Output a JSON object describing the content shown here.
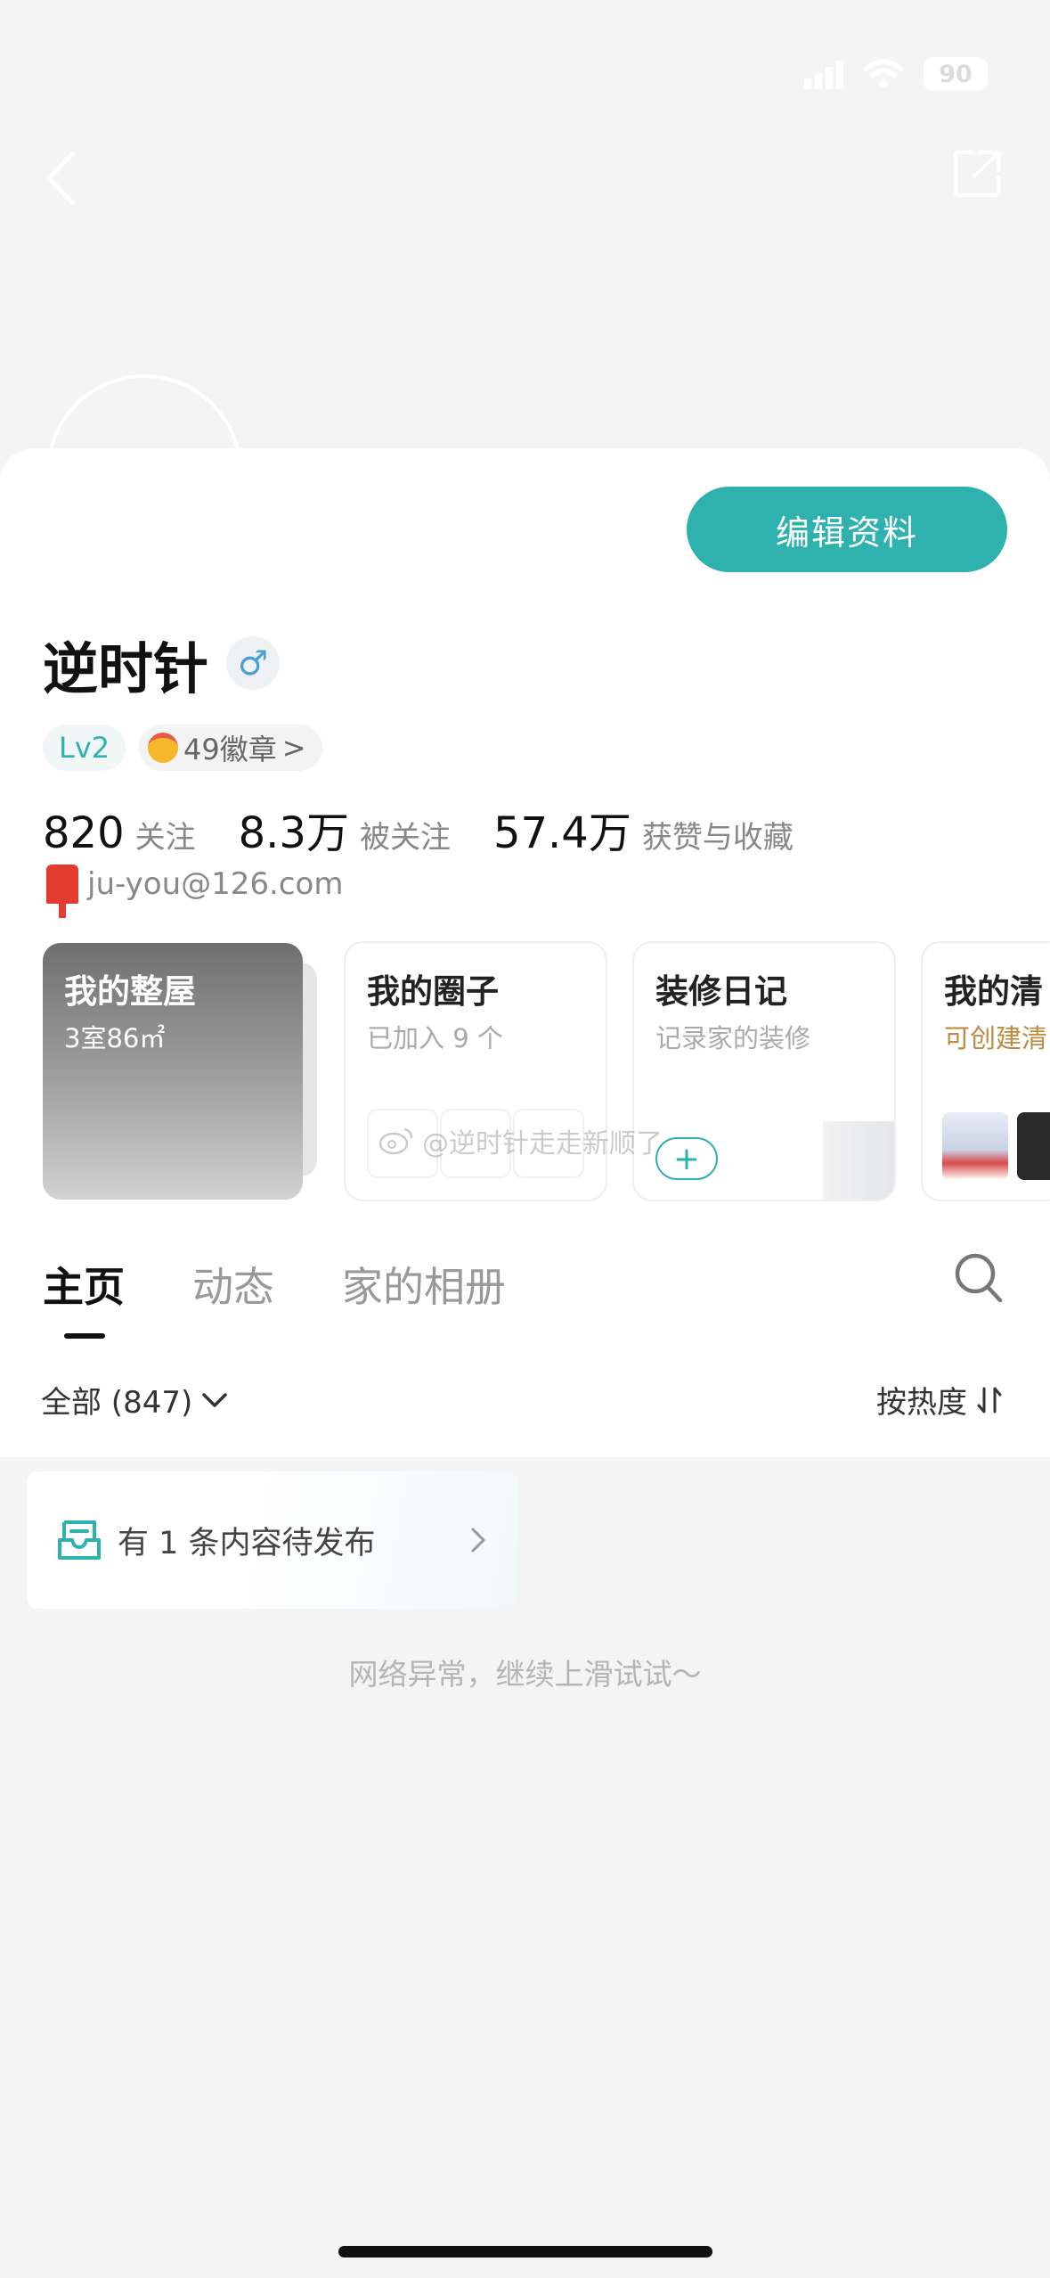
{
  "status_bar": {
    "battery": "90"
  },
  "profile": {
    "edit_label": "编辑资料",
    "name": "逆时针",
    "gender_symbol": "♂",
    "level": "Lv2",
    "badges": "49徽章",
    "badge_arrow": ">",
    "stats": [
      {
        "value": "820",
        "label": "关注"
      },
      {
        "value": "8.3万",
        "label": "被关注"
      },
      {
        "value": "57.4万",
        "label": "获赞与收藏"
      }
    ],
    "email": "ju-you@126.com"
  },
  "tiles": [
    {
      "title": "我的整屋",
      "subtitle": "3室86㎡"
    },
    {
      "title": "我的圈子",
      "subtitle": "已加入 9 个"
    },
    {
      "title": "装修日记",
      "subtitle": "记录家的装修"
    },
    {
      "title": "我的清",
      "subtitle": "可创建清"
    }
  ],
  "tabs": [
    "主页",
    "动态",
    "家的相册"
  ],
  "filter": {
    "label": "全部 (847)",
    "sort_label": "按热度"
  },
  "pending": {
    "text": "有 1 条内容待发布"
  },
  "network_message": "网络异常，继续上滑试试～",
  "watermark": "@逆时针走走新顺了",
  "colors": {
    "accent": "#2fb1ad",
    "email_icon": "#e23b2f",
    "gender": "#4a9fd6"
  }
}
